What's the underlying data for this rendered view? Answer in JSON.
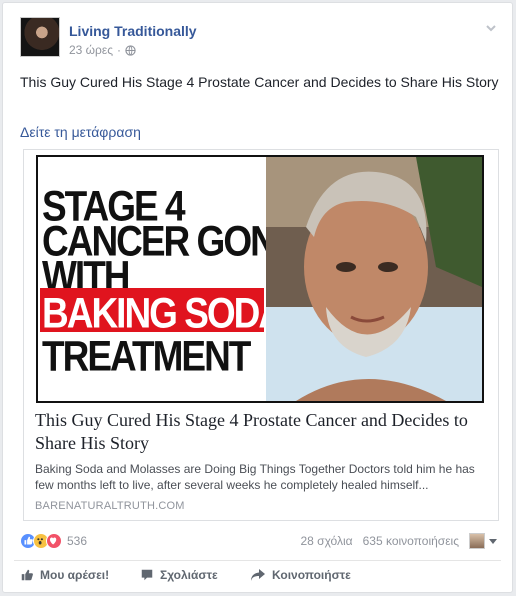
{
  "post": {
    "page_name": "Living Traditionally",
    "time": "23 ώρες",
    "separator": "·",
    "text": "This Guy Cured His Stage 4 Prostate Cancer and Decides to Share His Story",
    "translate_label": "Δείτε τη μετάφραση"
  },
  "link": {
    "image_lines": [
      "STAGE 4",
      "CANCER GONE",
      "WITH",
      "BAKING SODA",
      "TREATMENT"
    ],
    "title": "This Guy Cured His Stage 4 Prostate Cancer and Decides to Share His Story",
    "description": "Baking Soda and Molasses are Doing Big Things Together Doctors told him he has few months left to live, after several weeks he completely healed himself...",
    "domain": "BARENATURALTRUTH.COM"
  },
  "stats": {
    "reactions_count": "536",
    "comments": "28 σχόλια",
    "shares": "635 κοινοποιήσεις"
  },
  "actions": {
    "like": "Μου αρέσει!",
    "comment": "Σχολιάστε",
    "share": "Κοινοποιήστε"
  },
  "colors": {
    "link_blue": "#365899",
    "band_red": "#e0141e",
    "like_blue": "#5890ff",
    "wow_yellow": "#f7c142",
    "love_red": "#f25268"
  },
  "icons": [
    "globe-icon",
    "chevron-down-icon",
    "like-reaction-icon",
    "wow-reaction-icon",
    "love-reaction-icon",
    "thumbs-up-icon",
    "comment-icon",
    "share-icon",
    "caret-down-icon"
  ]
}
